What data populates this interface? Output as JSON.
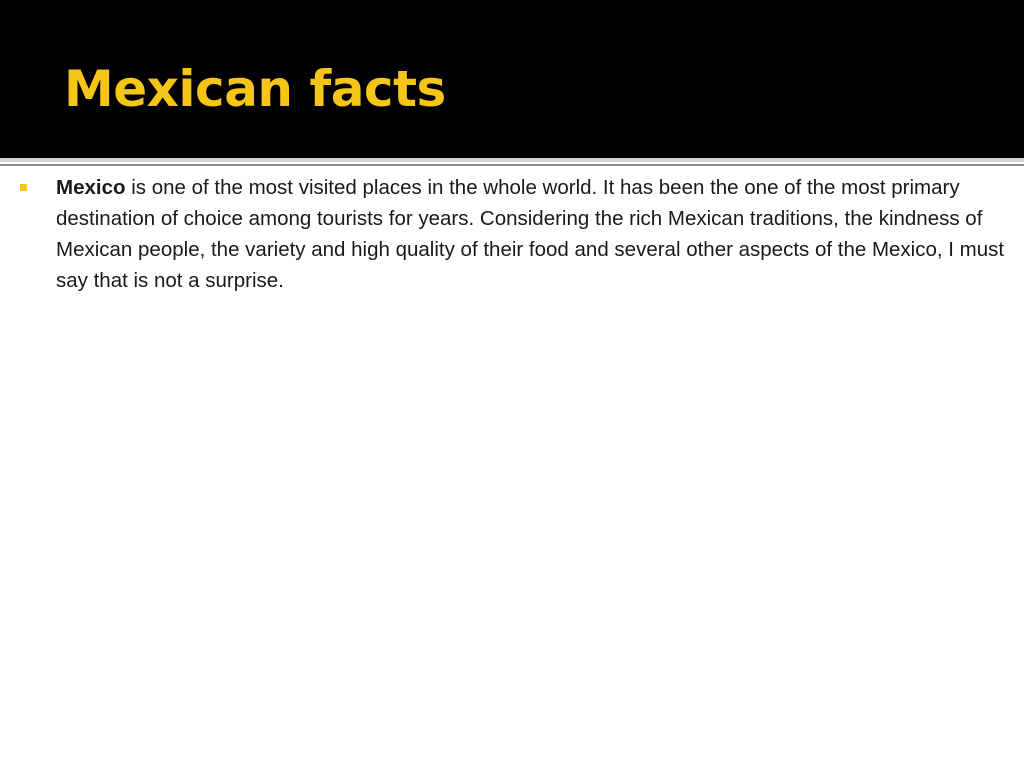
{
  "slide": {
    "title": "Mexican facts",
    "colors": {
      "title_bar": "#000000",
      "title_text": "#f5c518",
      "bullet": "#f5c518",
      "body_text": "#1a1a1a",
      "background": "#ffffff"
    },
    "bullets": [
      {
        "lead": "Mexico",
        "text": " is one of the most visited places in the whole world. It has been the one of the most primary destination of choice among tourists for years. Considering the rich Mexican traditions, the kindness of Mexican people, the variety and high quality of their food and several other aspects of the Mexico, I must say that is not a surprise."
      }
    ]
  }
}
